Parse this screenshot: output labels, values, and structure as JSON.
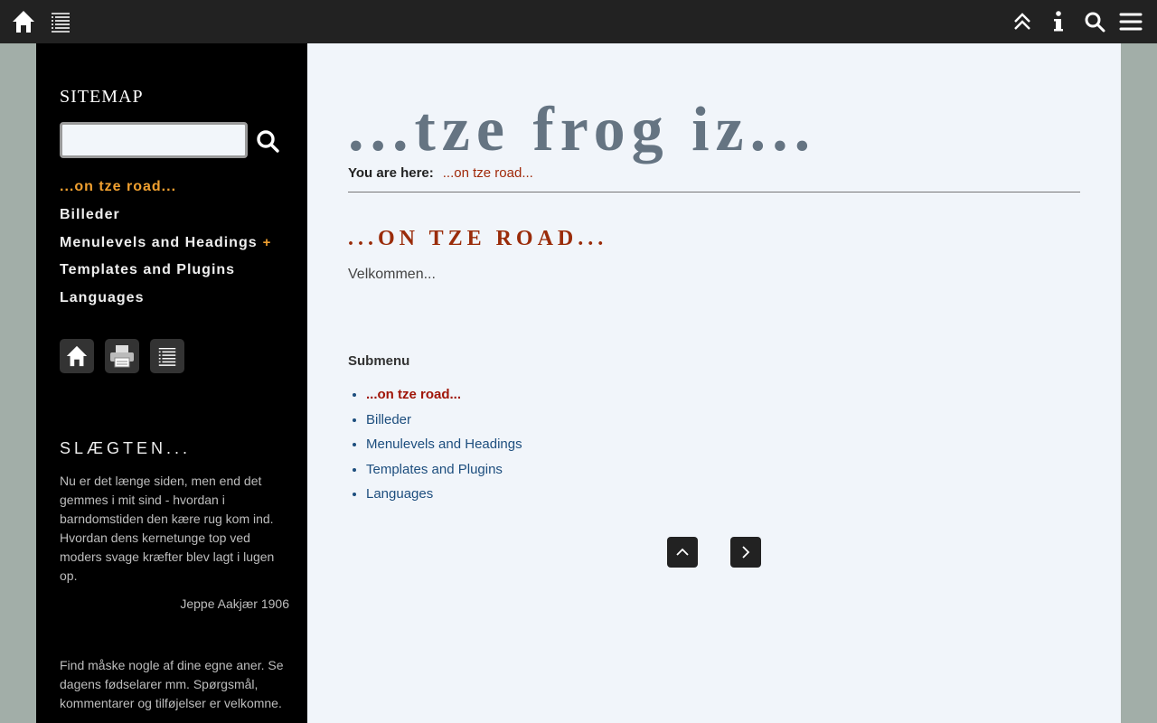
{
  "topbar": {
    "left_icons": [
      "home-icon",
      "sitemap-list-icon"
    ],
    "right_icons": [
      "double-chevron-up-icon",
      "info-icon",
      "search-icon",
      "hamburger-menu-icon"
    ]
  },
  "sidebar": {
    "sitemap_title": "SITEMAP",
    "search_value": "",
    "nav_items": [
      {
        "label": "...on tze road...",
        "active": true
      },
      {
        "label": "Billeder"
      },
      {
        "label": "Menulevels and Headings",
        "has_children": true,
        "plus": "+"
      },
      {
        "label": "Templates and Plugins"
      },
      {
        "label": "Languages"
      }
    ],
    "tools": [
      "home-icon",
      "print-icon",
      "sitemap-list-icon"
    ],
    "slaegt_title": "SLÆGTEN...",
    "poem": "Nu er det længe siden, men end det gemmes i mit sind - hvordan i barndomstiden den kære rug kom ind. Hvordan dens kernetunge top ved moders svage kræfter blev lagt i lugen op.",
    "poem_author": "Jeppe Aakjær 1906",
    "find_text": "Find måske nogle af dine egne aner. Se dagens fødselarer mm. Spørgsmål, kommentarer og tilføjelser er velkomne."
  },
  "main": {
    "site_title": "...tze frog iz...",
    "breadcrumb_label": "You are here:",
    "breadcrumb_item": "...on tze road...",
    "page_heading": "...on tze road...",
    "welcome": "Velkommen...",
    "submenu_title": "Submenu",
    "submenu_items": [
      {
        "label": "...on tze road...",
        "active": true
      },
      {
        "label": "Billeder"
      },
      {
        "label": "Menulevels and Headings"
      },
      {
        "label": "Templates and Plugins"
      },
      {
        "label": "Languages"
      }
    ],
    "pager_buttons": [
      "chevron-up-icon",
      "chevron-right-icon"
    ]
  },
  "colors": {
    "topbar_bg": "#222222",
    "sidebar_bg": "#000000",
    "main_bg": "#f1f5fa",
    "accent_orange": "#f0a030",
    "heading_red": "#9a2c0a",
    "link_blue": "#1d4e7e"
  }
}
